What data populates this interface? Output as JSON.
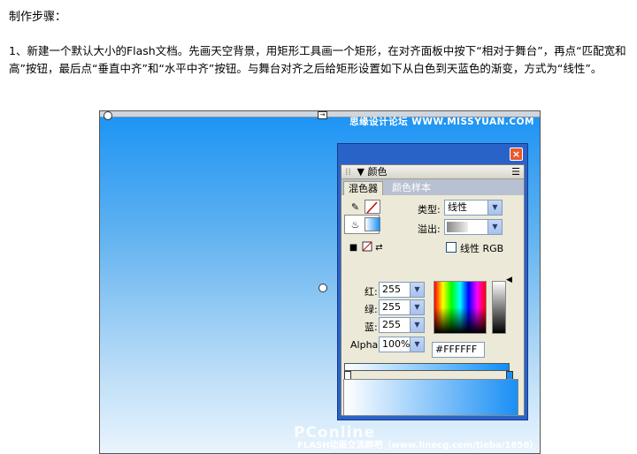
{
  "article": {
    "heading": "制作步骤：",
    "paragraph": "1、新建一个默认大小的Flash文档。先画天空背景，用矩形工具画一个矩形，在对齐面板中按下“相对于舞台”，再点“匹配宽和高”按钮，最后点“垂直中齐”和“水平中齐”按钮。与舞台对齐之后给矩形设置如下从白色到天蓝色的渐变，方式为“线性”。"
  },
  "stage": {
    "watermark_top": "思缘设计论坛 WWW.MISSYUAN.COM",
    "watermark_brand": "PConline",
    "watermark_bottom": "FLASH动画交流群吧（www.linecg.com/tieba/1856）"
  },
  "panel": {
    "close_icon": "×",
    "title": "▼ 颜色",
    "grip": "⁞⁞",
    "menu_icon": "☰",
    "tabs": [
      "混色器",
      "颜色样本"
    ],
    "type_label": "类型:",
    "type_value": "线性",
    "overflow_label": "溢出:",
    "linear_rgb_label": "线性 RGB",
    "red_label": "红:",
    "red_value": "255",
    "green_label": "绿:",
    "green_value": "255",
    "blue_label": "蓝:",
    "blue_value": "255",
    "alpha_label": "Alpha:",
    "alpha_value": "100%",
    "hex_value": "#FFFFFF",
    "dropdown_arrow": "▼"
  },
  "colors": {
    "gradient_start": "#FFFFFF",
    "gradient_end": "#1A8FF4",
    "stop_right": "#1A8FF4"
  },
  "icons": [
    "pencil-icon",
    "stroke-color-icon",
    "bucket-icon",
    "fill-color-icon",
    "default-colors-icon",
    "no-color-icon",
    "swap-colors-icon",
    "close-icon",
    "panel-menu-icon"
  ]
}
